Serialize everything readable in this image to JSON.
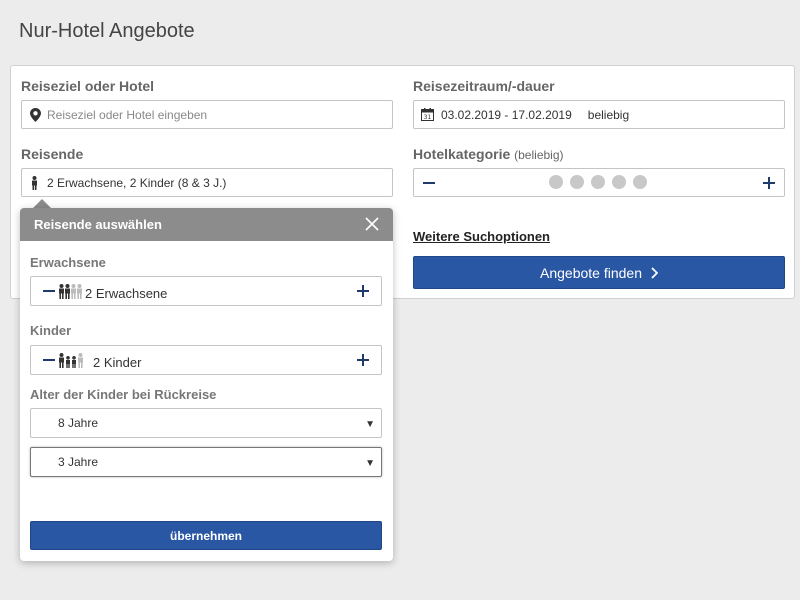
{
  "page": {
    "title": "Nur-Hotel Angebote"
  },
  "search": {
    "destination": {
      "label": "Reiseziel oder Hotel",
      "placeholder": "Reiseziel oder Hotel eingeben"
    },
    "travel_period": {
      "label": "Reisezeitraum/-dauer",
      "value": "03.02.2019 - 17.02.2019",
      "duration": "beliebig"
    },
    "travelers": {
      "label": "Reisende",
      "value": "2 Erwachsene, 2 Kinder (8 & 3 J.)"
    },
    "hotel_category": {
      "label": "Hotelkategorie",
      "sub_label": "(beliebig)",
      "stars_total": 5
    },
    "more_options": "Weitere Suchoptionen",
    "find_button": "Angebote finden"
  },
  "popup": {
    "title": "Reisende auswählen",
    "adults": {
      "label": "Erwachsene",
      "value": "2 Erwachsene"
    },
    "children": {
      "label": "Kinder",
      "value": "2 Kinder"
    },
    "ages_label": "Alter der Kinder bei Rückreise",
    "child_ages": [
      "8 Jahre",
      "3 Jahre"
    ],
    "apply_button": "übernehmen"
  },
  "colors": {
    "primary": "#2957a4",
    "popup_header": "#8c8c8c",
    "navy_icon": "#1f3a6b"
  }
}
